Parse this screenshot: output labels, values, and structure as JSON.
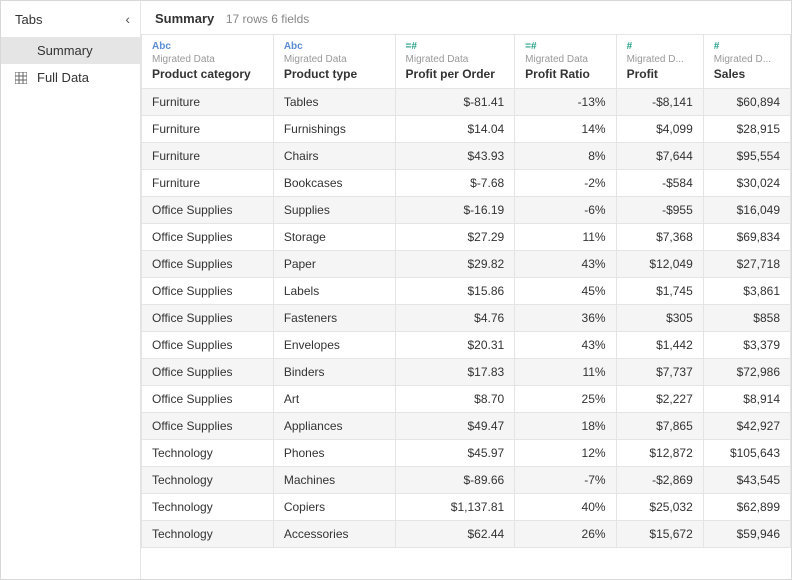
{
  "sidebar": {
    "title": "Tabs",
    "items": [
      {
        "label": "Summary",
        "icon": "",
        "active": true
      },
      {
        "label": "Full Data",
        "icon": "grid",
        "active": false
      }
    ]
  },
  "header": {
    "title": "Summary",
    "meta": "17 rows  6 fields"
  },
  "columns": [
    {
      "type": "abc",
      "type_label": "Abc",
      "source": "Migrated Data",
      "name": "Product category",
      "align": "left"
    },
    {
      "type": "abc",
      "type_label": "Abc",
      "source": "Migrated Data",
      "name": "Product type",
      "align": "left"
    },
    {
      "type": "hash",
      "type_label": "=#",
      "source": "Migrated Data",
      "name": "Profit per Order",
      "align": "right"
    },
    {
      "type": "hash",
      "type_label": "=#",
      "source": "Migrated Data",
      "name": "Profit Ratio",
      "align": "right"
    },
    {
      "type": "hash",
      "type_label": "#",
      "source": "Migrated D...",
      "name": "Profit",
      "align": "right"
    },
    {
      "type": "hash",
      "type_label": "#",
      "source": "Migrated D...",
      "name": "Sales",
      "align": "right"
    }
  ],
  "rows": [
    [
      "Furniture",
      "Tables",
      "$-81.41",
      "-13%",
      "-$8,141",
      "$60,894"
    ],
    [
      "Furniture",
      "Furnishings",
      "$14.04",
      "14%",
      "$4,099",
      "$28,915"
    ],
    [
      "Furniture",
      "Chairs",
      "$43.93",
      "8%",
      "$7,644",
      "$95,554"
    ],
    [
      "Furniture",
      "Bookcases",
      "$-7.68",
      "-2%",
      "-$584",
      "$30,024"
    ],
    [
      "Office Supplies",
      "Supplies",
      "$-16.19",
      "-6%",
      "-$955",
      "$16,049"
    ],
    [
      "Office Supplies",
      "Storage",
      "$27.29",
      "11%",
      "$7,368",
      "$69,834"
    ],
    [
      "Office Supplies",
      "Paper",
      "$29.82",
      "43%",
      "$12,049",
      "$27,718"
    ],
    [
      "Office Supplies",
      "Labels",
      "$15.86",
      "45%",
      "$1,745",
      "$3,861"
    ],
    [
      "Office Supplies",
      "Fasteners",
      "$4.76",
      "36%",
      "$305",
      "$858"
    ],
    [
      "Office Supplies",
      "Envelopes",
      "$20.31",
      "43%",
      "$1,442",
      "$3,379"
    ],
    [
      "Office Supplies",
      "Binders",
      "$17.83",
      "11%",
      "$7,737",
      "$72,986"
    ],
    [
      "Office Supplies",
      "Art",
      "$8.70",
      "25%",
      "$2,227",
      "$8,914"
    ],
    [
      "Office Supplies",
      "Appliances",
      "$49.47",
      "18%",
      "$7,865",
      "$42,927"
    ],
    [
      "Technology",
      "Phones",
      "$45.97",
      "12%",
      "$12,872",
      "$105,643"
    ],
    [
      "Technology",
      "Machines",
      "$-89.66",
      "-7%",
      "-$2,869",
      "$43,545"
    ],
    [
      "Technology",
      "Copiers",
      "$1,137.81",
      "40%",
      "$25,032",
      "$62,899"
    ],
    [
      "Technology",
      "Accessories",
      "$62.44",
      "26%",
      "$15,672",
      "$59,946"
    ]
  ]
}
